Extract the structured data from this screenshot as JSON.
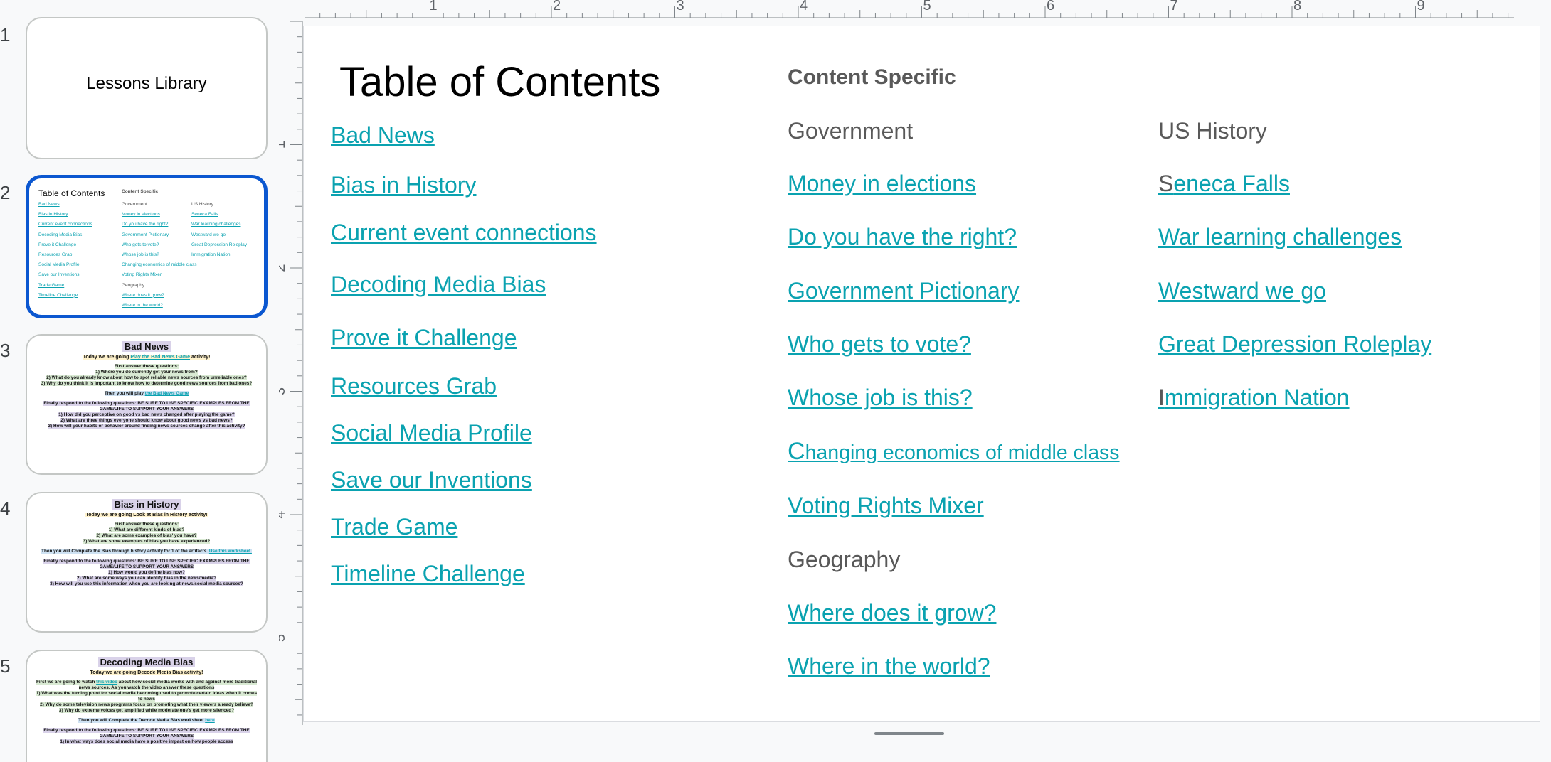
{
  "filmstrip": {
    "slides": [
      {
        "number": "1",
        "title": "Lessons Library"
      },
      {
        "number": "2",
        "title": "Table of Contents",
        "col1": [
          "Bad News",
          "Bias in History",
          "Current event connections",
          "Decoding Media Bias",
          "Prove it Challenge",
          "Resources Grab",
          "Social Media Profile",
          "Save our Inventions",
          "Trade Game",
          "Timeline Challenge"
        ],
        "content_specific": "Content Specific",
        "col2": [
          "Government",
          "Money in elections",
          "Do you have the right?",
          "Government Pictionary",
          "Who gets to vote?",
          "Whose job is this?",
          "Changing economics of middle class",
          "Voting Rights Mixer",
          "Geography",
          "Where does it grow?",
          "Where in the world?"
        ],
        "col3": [
          "US History",
          "Seneca Falls",
          "War learning challenges",
          "Westward we go",
          "Great Depression Roleplay",
          "Immigration Nation"
        ]
      },
      {
        "number": "3",
        "title": "Bad News",
        "sub_pre": "Today we are going ",
        "sub_link": "Play the Bad News Game",
        "sub_post": " activity!",
        "first": "First answer these questions:",
        "q1": "1)    Where you do currently get your news from?",
        "q2": "2)    What do you already know about how to spot reliable news sources from unreliable ones?",
        "q3": "3)    Why do you think it is important to know how to determine good news sources from bad ones?",
        "then_pre": "Then you will play ",
        "then_link": "the Bad News Game",
        "finally": "Finally respond to the following questions: BE SURE TO USE SPECIFIC EXAMPLES FROM THE GAME/LIFE TO SUPPORT YOUR ANSWERS",
        "f1": "1)    How did you perceptive on good vs bad news changed after playing the game?",
        "f2": "2)    What are three things everyone should know about good news vs bad news?",
        "f3": "3)    How will your habits or behavior around finding news sources change after this activity?"
      },
      {
        "number": "4",
        "title": "Bias in History",
        "sub_pre": "Today we are going ",
        "sub_link": "Look at Bias in History",
        "sub_post": " activity!",
        "first": "First answer these questions:",
        "q1": "1)    What are different kinds of bias?",
        "q2": "2)    What are some examples of bias' you have?",
        "q3": "3)    What are some examples of bias you have experienced?",
        "then_pre": "Then you will Complete the Bias through history activity for 1 of the artifacts. ",
        "then_link": "Use this worksheet.",
        "finally": "Finally respond to the following questions: BE SURE TO USE SPECIFIC EXAMPLES FROM THE GAME/LIFE TO SUPPORT YOUR ANSWERS",
        "f1": "1)    How would you define bias now?",
        "f2": "2)    What are some ways you can identify bias in the news/media?",
        "f3": "3)    How will you use this information when you are looking at news/social media sources?"
      },
      {
        "number": "5",
        "title": "Decoding Media Bias",
        "sub_pre": "Today we are going ",
        "sub_link": "Decode Media Bias",
        "sub_post": " activity!",
        "first_pre": "First we are going to watch ",
        "first_link": "this video",
        "first_post": " about how social media works with and against more traditional news sources. As you watch the video answer these questions",
        "q1": "1)    What was the turning point for social media becoming used to promote certain ideas when it comes to news",
        "q2": "2)    Why do some television news programs focus on promoting what their viewers already believe?",
        "q3": "3)    Why do extreme voices get amplified while moderate one's get more silenced?",
        "then_pre": "Then you will Complete the Decode Media Bias worksheet ",
        "then_link": "here",
        "finally": "Finally respond to the following questions: BE SURE TO USE SPECIFIC EXAMPLES FROM THE GAME/LIFE TO SUPPORT YOUR ANSWERS",
        "f1": "1)    In what ways does social media have a positive impact on how people access"
      }
    ]
  },
  "ruler": {
    "h_labels": [
      "1",
      "2",
      "3",
      "4",
      "5",
      "6",
      "7",
      "8",
      "9"
    ],
    "v_labels": [
      "1",
      "2",
      "3",
      "4",
      "5"
    ]
  },
  "slide": {
    "title": "Table of Contents",
    "left_links": [
      "Bad News",
      "Bias in History",
      "Current event connections",
      "Decoding Media Bias",
      "Prove it Challenge",
      "Resources Grab",
      "Social Media Profile",
      "Save our Inventions",
      "Trade Game",
      "Timeline Challenge"
    ],
    "content_specific": "Content Specific",
    "government": {
      "heading": "Government",
      "money": "Money in elections",
      "right": "Do you have the right?",
      "pictionary": "Government Pictionary",
      "vote": "Who gets to vote?",
      "job": "Whose job is this?",
      "changing_first": "C",
      "changing_rest": "hanging economics of middle class",
      "mixer": "Voting Rights Mixer"
    },
    "geography": {
      "heading": "Geography",
      "grow": "Where does it grow?",
      "world": "Where in the world?"
    },
    "us_history": {
      "heading": "US History",
      "seneca_first": "S",
      "seneca_rest": "eneca Falls",
      "war": "War learning challenges",
      "westward": "Westward we go",
      "depression": "Great Depression Roleplay",
      "immigration_first": "I",
      "immigration_rest": "mmigration Nation"
    }
  }
}
